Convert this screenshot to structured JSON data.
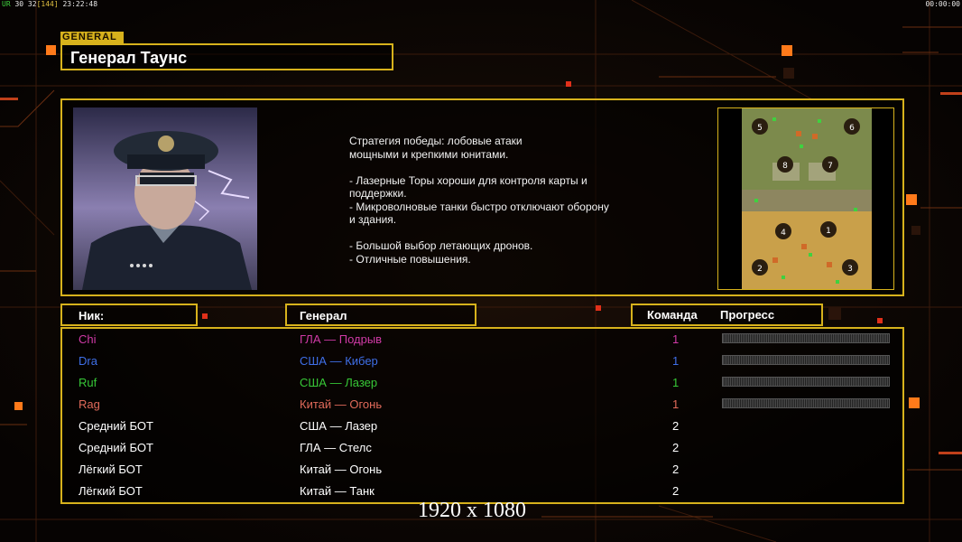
{
  "hud": {
    "left_a": "UR",
    "left_b": "30 32",
    "left_c": "[144]",
    "left_time": "23:22:48",
    "right_time": "00:00:00"
  },
  "general_tag": "GENERAL",
  "general_name": "Генерал Таунс",
  "description": "Стратегия победы: лобовые атаки\nмощными и крепкими юнитами.\n\n- Лазерные Торы хороши для контроля карты и\n поддержки.\n- Микроволновые танки быстро отключают оборону\n и здания.\n\n- Большой выбор летающих дронов.\n- Отличные повышения.",
  "headers": {
    "nick": "Ник:",
    "general": "Генерал",
    "team": "Команда",
    "progress": "Прогресс"
  },
  "map_slots": [
    "5",
    "6",
    "8",
    "7",
    "4",
    "1",
    "2",
    "3"
  ],
  "players": [
    {
      "nick": "Chi",
      "general": "ГЛА — Подрыв",
      "team": "1",
      "color": "#d03aa6",
      "progress": true
    },
    {
      "nick": "Dra",
      "general": "США — Кибер",
      "team": "1",
      "color": "#3f6fe8",
      "progress": true
    },
    {
      "nick": "Ruf",
      "general": "США — Лазер",
      "team": "1",
      "color": "#37c837",
      "progress": true
    },
    {
      "nick": "Rag",
      "general": "Китай — Огонь",
      "team": "1",
      "color": "#e06a5a",
      "progress": true
    },
    {
      "nick": "Средний БОТ",
      "general": "США — Лазер",
      "team": "2",
      "color": "#ffffff",
      "progress": false
    },
    {
      "nick": "Средний БОТ",
      "general": "ГЛА — Стелс",
      "team": "2",
      "color": "#ffffff",
      "progress": false
    },
    {
      "nick": "Лёгкий БОТ",
      "general": "Китай — Огонь",
      "team": "2",
      "color": "#ffffff",
      "progress": false
    },
    {
      "nick": "Лёгкий БОТ",
      "general": "Китай — Танк",
      "team": "2",
      "color": "#ffffff",
      "progress": false
    }
  ],
  "team_color_row": [
    "#d03aa6",
    "#3f6fe8",
    "#37c837",
    "#e06a5a"
  ],
  "resolution": "1920 x 1080",
  "colors": {
    "frame": "#d7b21c",
    "accent_orange": "#ff7a1a"
  }
}
